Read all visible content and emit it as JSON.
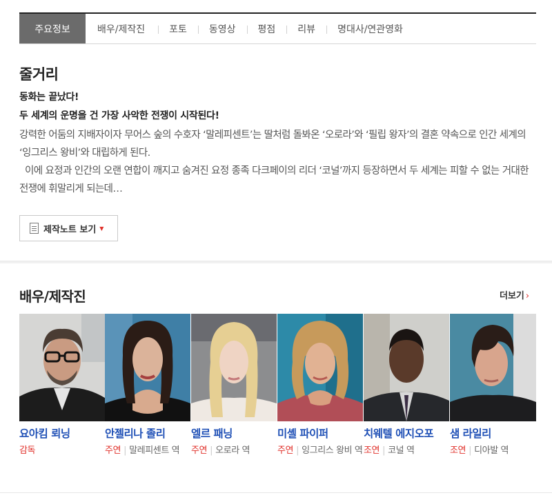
{
  "tabs": [
    {
      "label": "주요정보",
      "active": true
    },
    {
      "label": "배우/제작진",
      "active": false
    },
    {
      "label": "포토",
      "active": false
    },
    {
      "label": "동영상",
      "active": false
    },
    {
      "label": "평점",
      "active": false
    },
    {
      "label": "리뷰",
      "active": false
    },
    {
      "label": "명대사/연관영화",
      "active": false
    }
  ],
  "synopsis": {
    "title": "줄거리",
    "subtitle1": "동화는 끝났다!",
    "subtitle2": "두 세계의 운명을 건 가장 사악한 전쟁이 시작된다!",
    "body1": "강력한 어둠의 지배자이자 무어스 숲의 수호자 ‘말레피센트’는 딸처럼 돌봐온 ‘오로라’와 ‘필립 왕자’의 결혼 약속으로 인간 세계의 ‘잉그리스 왕비’와 대립하게 된다.",
    "body2": "이에 요정과 인간의 오랜 연합이 깨지고 숨겨진 요정 종족 다크페이의 리더 ‘코널’까지 등장하면서 두 세계는 피할 수 없는 거대한 전쟁에 휘말리게 되는데…",
    "note_button": "제작노트 보기"
  },
  "cast": {
    "title": "배우/제작진",
    "more": "더보기",
    "members": [
      {
        "name": "요아킴 뢰닝",
        "type": "감독",
        "role": ""
      },
      {
        "name": "안젤리나 졸리",
        "type": "주연",
        "role": "말레피센트 역"
      },
      {
        "name": "엘르 패닝",
        "type": "주연",
        "role": "오로라 역"
      },
      {
        "name": "미셸 파이퍼",
        "type": "주연",
        "role": "잉그리스 왕비 역"
      },
      {
        "name": "치웨텔 에지오포",
        "type": "조연",
        "role": "코널 역"
      },
      {
        "name": "샘 라일리",
        "type": "조연",
        "role": "디아발 역"
      }
    ]
  },
  "colors": {
    "accent_red": "#e0302a",
    "link_blue": "#1f50b6",
    "active_tab_bg": "#6b6b6b"
  }
}
